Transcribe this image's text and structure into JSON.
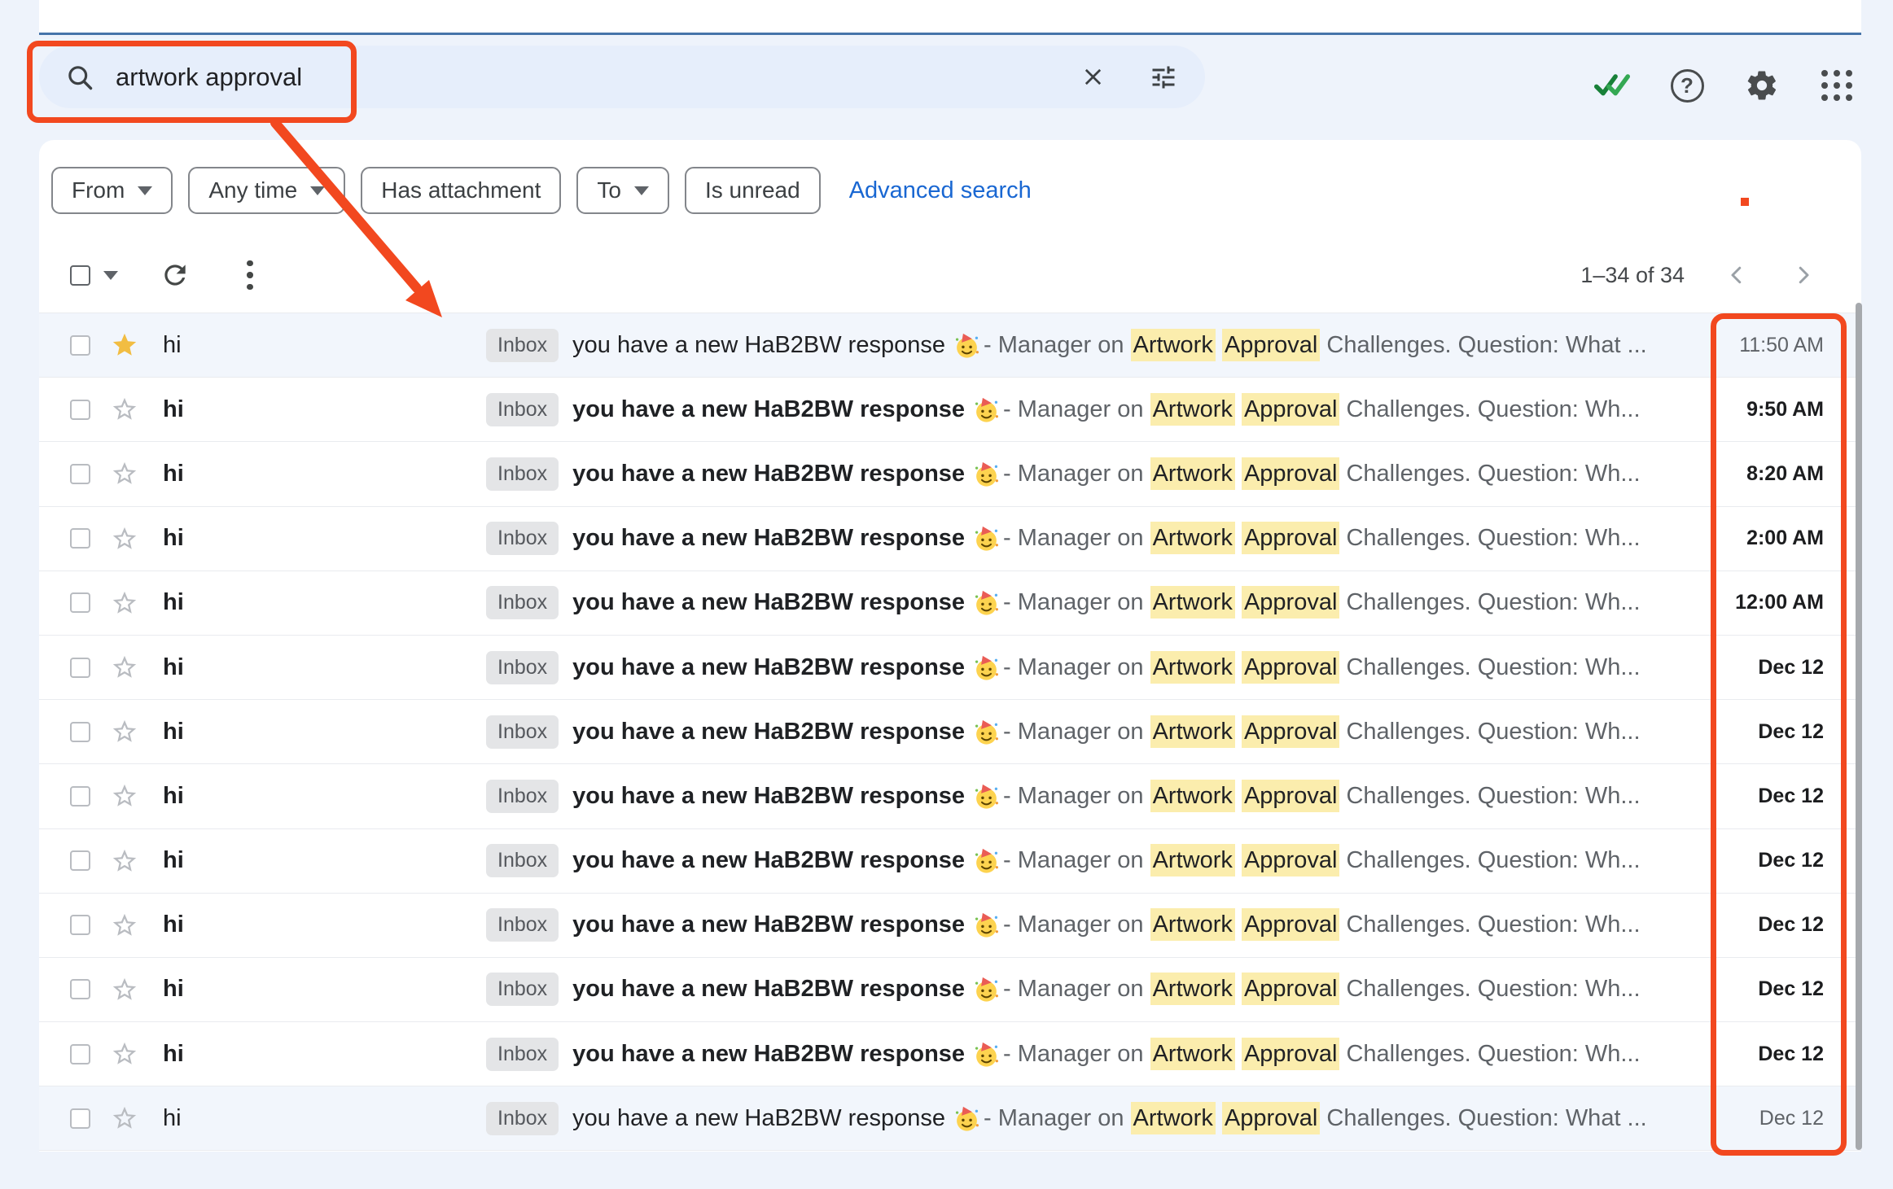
{
  "colors": {
    "annotation_red": "#F2481F",
    "highlight_yellow": "#FBEDAD",
    "star_gold": "#F2BD42",
    "link_blue": "#1967D2",
    "check_green_dark": "#188038",
    "check_green_light": "#34A853",
    "top_line_blue": "#4674A9",
    "read_row_bg": "#F2F6FC"
  },
  "header": {
    "search": {
      "query": "artwork approval",
      "icons": [
        "search-icon",
        "clear-icon",
        "search-options-icon"
      ]
    },
    "right_icons": [
      "double-check-icon",
      "help-icon",
      "settings-gear-icon",
      "apps-grid-icon"
    ],
    "help_glyph": "?"
  },
  "filters": {
    "chips": [
      {
        "label": "From",
        "caret": true
      },
      {
        "label": "Any time",
        "caret": true
      },
      {
        "label": "Has attachment",
        "caret": false
      },
      {
        "label": "To",
        "caret": true
      },
      {
        "label": "Is unread",
        "caret": false
      }
    ],
    "advanced_link": "Advanced search"
  },
  "toolbar": {
    "pagination": "1–34 of 34",
    "icons": [
      "select-all-checkbox",
      "refresh-icon",
      "more-options-icon",
      "prev-page-icon",
      "next-page-icon"
    ]
  },
  "email_list": {
    "badge_label": "Inbox",
    "subject": "you have a new HaB2BW response",
    "emoji": "🥳",
    "separator": "-",
    "snippet_prefix": "Manager on",
    "highlight_terms": [
      "Artwork",
      "Approval"
    ],
    "snippet_suffix_unread": "Challenges. Question: Wh...",
    "snippet_suffix_read": "Challenges. Question: What ...",
    "rows": [
      {
        "sender": "hi",
        "date": "11:50 AM",
        "unread": false,
        "starred": true
      },
      {
        "sender": "hi",
        "date": "9:50 AM",
        "unread": true,
        "starred": false
      },
      {
        "sender": "hi",
        "date": "8:20 AM",
        "unread": true,
        "starred": false
      },
      {
        "sender": "hi",
        "date": "2:00 AM",
        "unread": true,
        "starred": false
      },
      {
        "sender": "hi",
        "date": "12:00 AM",
        "unread": true,
        "starred": false
      },
      {
        "sender": "hi",
        "date": "Dec 12",
        "unread": true,
        "starred": false
      },
      {
        "sender": "hi",
        "date": "Dec 12",
        "unread": true,
        "starred": false
      },
      {
        "sender": "hi",
        "date": "Dec 12",
        "unread": true,
        "starred": false
      },
      {
        "sender": "hi",
        "date": "Dec 12",
        "unread": true,
        "starred": false
      },
      {
        "sender": "hi",
        "date": "Dec 12",
        "unread": true,
        "starred": false
      },
      {
        "sender": "hi",
        "date": "Dec 12",
        "unread": true,
        "starred": false
      },
      {
        "sender": "hi",
        "date": "Dec 12",
        "unread": true,
        "starred": false
      },
      {
        "sender": "hi",
        "date": "Dec 12",
        "unread": false,
        "starred": false
      }
    ]
  }
}
